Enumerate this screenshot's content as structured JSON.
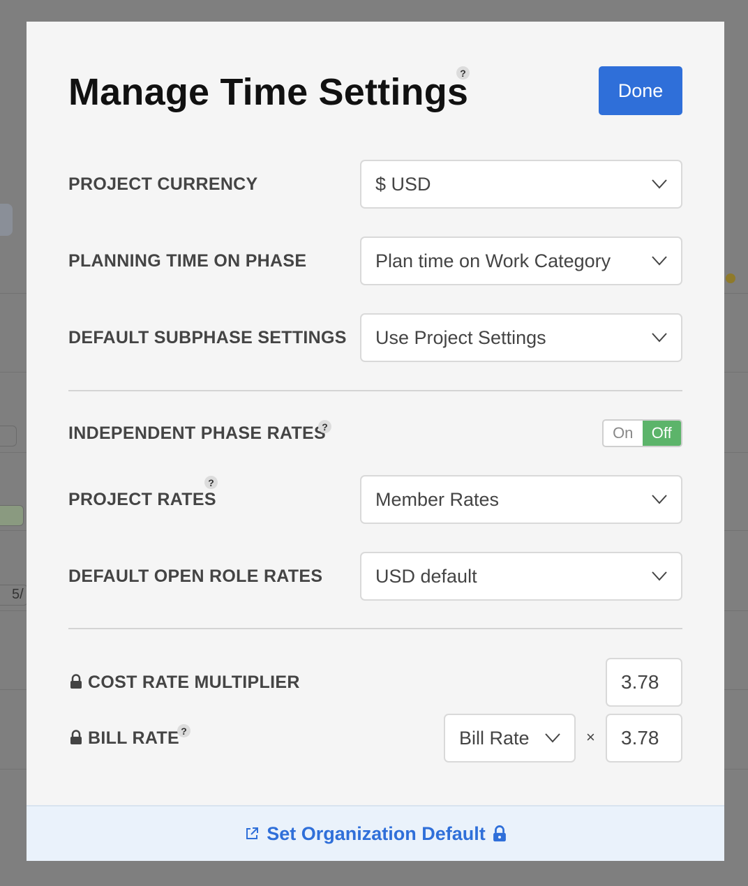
{
  "background": {
    "pill_1": "5/"
  },
  "modal": {
    "title": "Manage Time Settings",
    "help_glyph": "?",
    "done_label": "Done"
  },
  "settings": {
    "project_currency": {
      "label": "PROJECT CURRENCY",
      "value": "$ USD"
    },
    "planning_time": {
      "label": "PLANNING TIME ON PHASE",
      "value": "Plan time on Work Category"
    },
    "default_subphase": {
      "label": "DEFAULT SUBPHASE SETTINGS",
      "value": "Use Project Settings"
    },
    "independent_phase_rates": {
      "label": "INDEPENDENT PHASE RATES",
      "on_label": "On",
      "off_label": "Off",
      "selected": "Off"
    },
    "project_rates": {
      "label": "PROJECT RATES",
      "value": "Member Rates"
    },
    "default_open_role_rates": {
      "label": "DEFAULT OPEN ROLE RATES",
      "value": "USD default"
    },
    "cost_rate_multiplier": {
      "label": "COST RATE MULTIPLIER",
      "value": "3.78"
    },
    "bill_rate": {
      "label": "BILL RATE",
      "select_value": "Bill Rate",
      "operator": "×",
      "multiplier": "3.78"
    }
  },
  "footer": {
    "link_label": "Set Organization Default"
  },
  "colors": {
    "primary": "#2f6fd9",
    "toggle_active": "#5cb46a",
    "footer_bg": "#eaf2fb"
  },
  "icons": [
    "help-icon",
    "chevron-down-icon",
    "lock-icon",
    "external-link-icon"
  ]
}
